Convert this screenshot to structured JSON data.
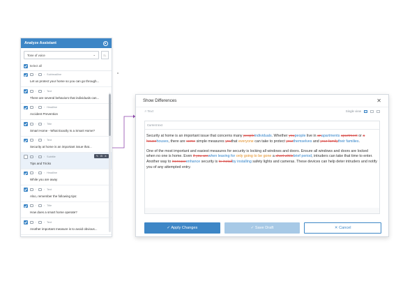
{
  "assistant": {
    "title": "Analyze Assistant",
    "tone_label": "Tone of voice",
    "tone_btn": "≡↓",
    "select_all": "Select all",
    "items": [
      {
        "meta": "Subheadline",
        "text": "Let us protect your home so you can go through...",
        "checked": true
      },
      {
        "meta": "Text",
        "text": "There are several behaviors that individuals can...",
        "checked": true
      },
      {
        "meta": "Headline",
        "text": "Accident Prevention",
        "checked": true
      },
      {
        "meta": "Title",
        "text": "Smart Home - What Exactly Is a Smart Home?",
        "checked": true
      },
      {
        "meta": "Text",
        "text": "Security at home is an important issue that...",
        "checked": true
      },
      {
        "meta": "Subtitle",
        "text": "Tips and Tricks",
        "checked": false
      },
      {
        "meta": "Headline",
        "text": "While you are away",
        "checked": true
      },
      {
        "meta": "Text",
        "text": "Also, remember the following tips:",
        "checked": true
      },
      {
        "meta": "Title",
        "text": "How does a smart home operate?",
        "checked": true
      },
      {
        "meta": "Text",
        "text": "Another important measure is to avoid obvious...",
        "checked": true
      }
    ]
  },
  "dialog": {
    "title": "Show Differences",
    "close": "✕",
    "subheader": "Text",
    "view_label": "Single view",
    "content_label": "Current text",
    "buttons": {
      "apply": "✓  Apply Changes",
      "save": "✓  Save Draft",
      "cancel": "✕  Cancel"
    }
  },
  "colors": {
    "accent": "#3d86c6",
    "deleted": "#d9534f",
    "inserted": "#2f80c7"
  }
}
